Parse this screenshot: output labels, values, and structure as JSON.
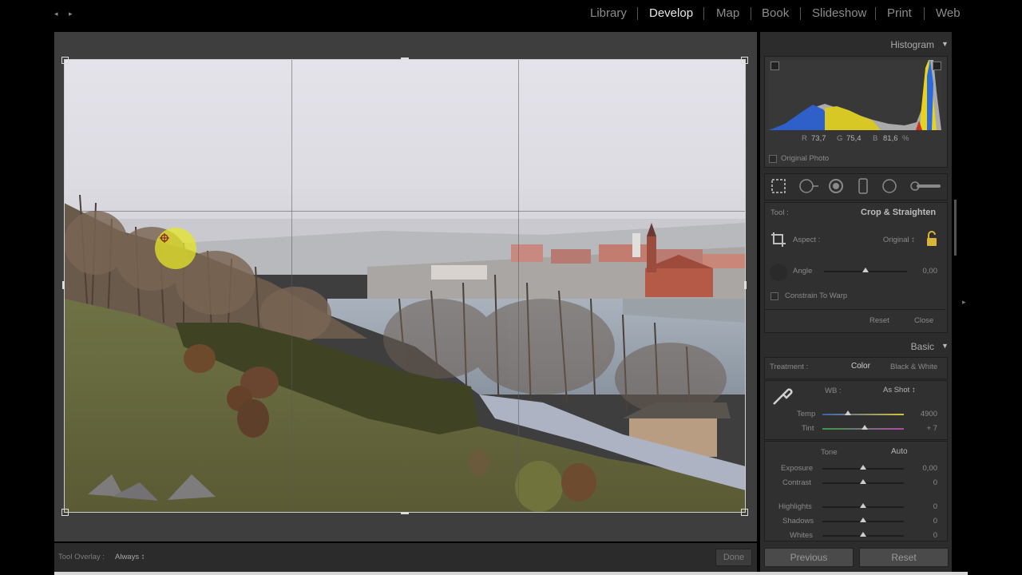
{
  "modules": {
    "library": "Library",
    "develop": "Develop",
    "map": "Map",
    "book": "Book",
    "slideshow": "Slideshow",
    "print": "Print",
    "web": "Web"
  },
  "histogram": {
    "title": "Histogram",
    "r_label": "R",
    "r_value": "73,7",
    "g_label": "G",
    "g_value": "75,4",
    "b_label": "B",
    "b_value": "81,6",
    "unit": "%",
    "original_photo": "Original Photo"
  },
  "crop": {
    "tool_label": "Tool :",
    "tool_name": "Crop & Straighten",
    "aspect_label": "Aspect :",
    "aspect_value": "Original ↕",
    "angle_label": "Angle",
    "angle_value": "0,00",
    "constrain": "Constrain To Warp",
    "reset": "Reset",
    "close": "Close"
  },
  "basic": {
    "title": "Basic",
    "treatment_label": "Treatment :",
    "color": "Color",
    "bw": "Black & White",
    "wb_label": "WB :",
    "wb_value": "As Shot ↕",
    "temp_label": "Temp",
    "temp_value": "4900",
    "tint_label": "Tint",
    "tint_value": "+ 7",
    "tone_label": "Tone",
    "auto": "Auto",
    "exposure_label": "Exposure",
    "exposure_value": "0,00",
    "contrast_label": "Contrast",
    "contrast_value": "0",
    "highlights_label": "Highlights",
    "highlights_value": "0",
    "shadows_label": "Shadows",
    "shadows_value": "0",
    "whites_label": "Whites",
    "whites_value": "0"
  },
  "toolbar": {
    "overlay_label": "Tool Overlay :",
    "overlay_value": "Always ↕",
    "done": "Done",
    "previous": "Previous",
    "reset": "Reset"
  },
  "colors": {
    "panel_bg": "#2c2c2c",
    "active_module": "#e8e8e8",
    "inactive_module": "#8c8c8c"
  }
}
